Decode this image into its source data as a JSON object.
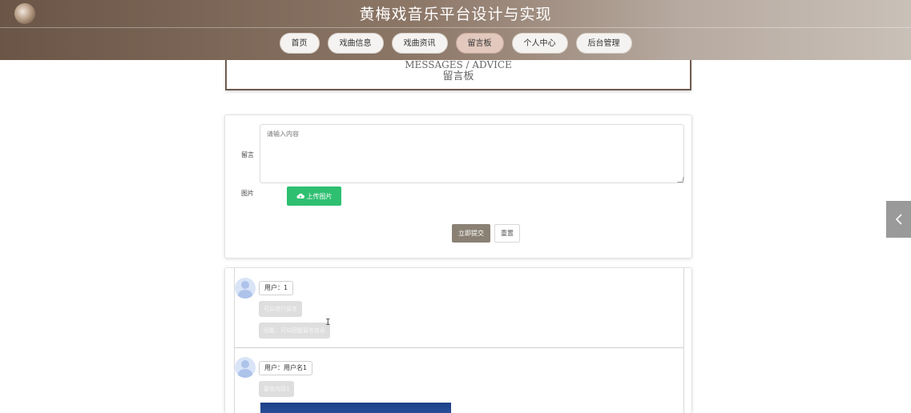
{
  "header": {
    "site_title": "黄梅戏音乐平台设计与实现",
    "nav": [
      {
        "label": "首页",
        "active": false
      },
      {
        "label": "戏曲信息",
        "active": false
      },
      {
        "label": "戏曲资讯",
        "active": false
      },
      {
        "label": "留言板",
        "active": true
      },
      {
        "label": "个人中心",
        "active": false
      },
      {
        "label": "后台管理",
        "active": false
      }
    ]
  },
  "section_title": {
    "english": "MESSAGES / ADVICE",
    "chinese": "留言板"
  },
  "form": {
    "message_label": "留言",
    "message_placeholder": "请输入内容",
    "image_label": "图片",
    "upload_label": "上传图片",
    "submit_label": "立即提交",
    "reset_label": "重置"
  },
  "messages": [
    {
      "user": "用户：1",
      "content": "可以进行留言",
      "reply": "回复：可以回复留言信息"
    },
    {
      "user": "用户：用户名1",
      "content": "留言内容1"
    }
  ],
  "colors": {
    "accent_green": "#2fbf71",
    "submit_bg": "#8a8174",
    "active_nav": "#e2c8bd"
  }
}
